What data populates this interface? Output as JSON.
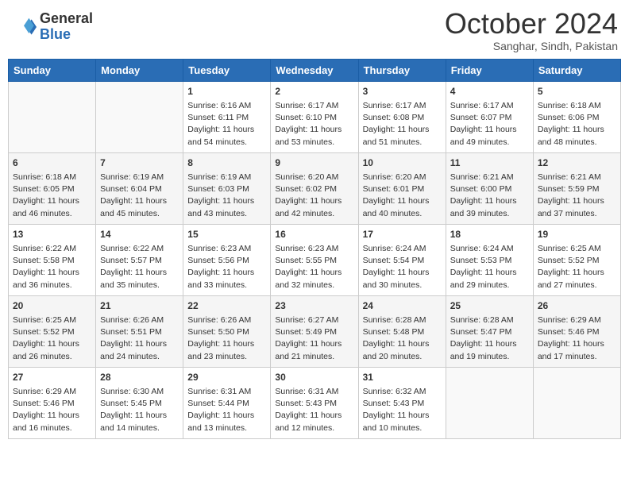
{
  "header": {
    "logo_general": "General",
    "logo_blue": "Blue",
    "month": "October 2024",
    "location": "Sanghar, Sindh, Pakistan"
  },
  "days_of_week": [
    "Sunday",
    "Monday",
    "Tuesday",
    "Wednesday",
    "Thursday",
    "Friday",
    "Saturday"
  ],
  "weeks": [
    [
      {
        "day": "",
        "info": ""
      },
      {
        "day": "",
        "info": ""
      },
      {
        "day": "1",
        "info": "Sunrise: 6:16 AM\nSunset: 6:11 PM\nDaylight: 11 hours and 54 minutes."
      },
      {
        "day": "2",
        "info": "Sunrise: 6:17 AM\nSunset: 6:10 PM\nDaylight: 11 hours and 53 minutes."
      },
      {
        "day": "3",
        "info": "Sunrise: 6:17 AM\nSunset: 6:08 PM\nDaylight: 11 hours and 51 minutes."
      },
      {
        "day": "4",
        "info": "Sunrise: 6:17 AM\nSunset: 6:07 PM\nDaylight: 11 hours and 49 minutes."
      },
      {
        "day": "5",
        "info": "Sunrise: 6:18 AM\nSunset: 6:06 PM\nDaylight: 11 hours and 48 minutes."
      }
    ],
    [
      {
        "day": "6",
        "info": "Sunrise: 6:18 AM\nSunset: 6:05 PM\nDaylight: 11 hours and 46 minutes."
      },
      {
        "day": "7",
        "info": "Sunrise: 6:19 AM\nSunset: 6:04 PM\nDaylight: 11 hours and 45 minutes."
      },
      {
        "day": "8",
        "info": "Sunrise: 6:19 AM\nSunset: 6:03 PM\nDaylight: 11 hours and 43 minutes."
      },
      {
        "day": "9",
        "info": "Sunrise: 6:20 AM\nSunset: 6:02 PM\nDaylight: 11 hours and 42 minutes."
      },
      {
        "day": "10",
        "info": "Sunrise: 6:20 AM\nSunset: 6:01 PM\nDaylight: 11 hours and 40 minutes."
      },
      {
        "day": "11",
        "info": "Sunrise: 6:21 AM\nSunset: 6:00 PM\nDaylight: 11 hours and 39 minutes."
      },
      {
        "day": "12",
        "info": "Sunrise: 6:21 AM\nSunset: 5:59 PM\nDaylight: 11 hours and 37 minutes."
      }
    ],
    [
      {
        "day": "13",
        "info": "Sunrise: 6:22 AM\nSunset: 5:58 PM\nDaylight: 11 hours and 36 minutes."
      },
      {
        "day": "14",
        "info": "Sunrise: 6:22 AM\nSunset: 5:57 PM\nDaylight: 11 hours and 35 minutes."
      },
      {
        "day": "15",
        "info": "Sunrise: 6:23 AM\nSunset: 5:56 PM\nDaylight: 11 hours and 33 minutes."
      },
      {
        "day": "16",
        "info": "Sunrise: 6:23 AM\nSunset: 5:55 PM\nDaylight: 11 hours and 32 minutes."
      },
      {
        "day": "17",
        "info": "Sunrise: 6:24 AM\nSunset: 5:54 PM\nDaylight: 11 hours and 30 minutes."
      },
      {
        "day": "18",
        "info": "Sunrise: 6:24 AM\nSunset: 5:53 PM\nDaylight: 11 hours and 29 minutes."
      },
      {
        "day": "19",
        "info": "Sunrise: 6:25 AM\nSunset: 5:52 PM\nDaylight: 11 hours and 27 minutes."
      }
    ],
    [
      {
        "day": "20",
        "info": "Sunrise: 6:25 AM\nSunset: 5:52 PM\nDaylight: 11 hours and 26 minutes."
      },
      {
        "day": "21",
        "info": "Sunrise: 6:26 AM\nSunset: 5:51 PM\nDaylight: 11 hours and 24 minutes."
      },
      {
        "day": "22",
        "info": "Sunrise: 6:26 AM\nSunset: 5:50 PM\nDaylight: 11 hours and 23 minutes."
      },
      {
        "day": "23",
        "info": "Sunrise: 6:27 AM\nSunset: 5:49 PM\nDaylight: 11 hours and 21 minutes."
      },
      {
        "day": "24",
        "info": "Sunrise: 6:28 AM\nSunset: 5:48 PM\nDaylight: 11 hours and 20 minutes."
      },
      {
        "day": "25",
        "info": "Sunrise: 6:28 AM\nSunset: 5:47 PM\nDaylight: 11 hours and 19 minutes."
      },
      {
        "day": "26",
        "info": "Sunrise: 6:29 AM\nSunset: 5:46 PM\nDaylight: 11 hours and 17 minutes."
      }
    ],
    [
      {
        "day": "27",
        "info": "Sunrise: 6:29 AM\nSunset: 5:46 PM\nDaylight: 11 hours and 16 minutes."
      },
      {
        "day": "28",
        "info": "Sunrise: 6:30 AM\nSunset: 5:45 PM\nDaylight: 11 hours and 14 minutes."
      },
      {
        "day": "29",
        "info": "Sunrise: 6:31 AM\nSunset: 5:44 PM\nDaylight: 11 hours and 13 minutes."
      },
      {
        "day": "30",
        "info": "Sunrise: 6:31 AM\nSunset: 5:43 PM\nDaylight: 11 hours and 12 minutes."
      },
      {
        "day": "31",
        "info": "Sunrise: 6:32 AM\nSunset: 5:43 PM\nDaylight: 11 hours and 10 minutes."
      },
      {
        "day": "",
        "info": ""
      },
      {
        "day": "",
        "info": ""
      }
    ]
  ]
}
